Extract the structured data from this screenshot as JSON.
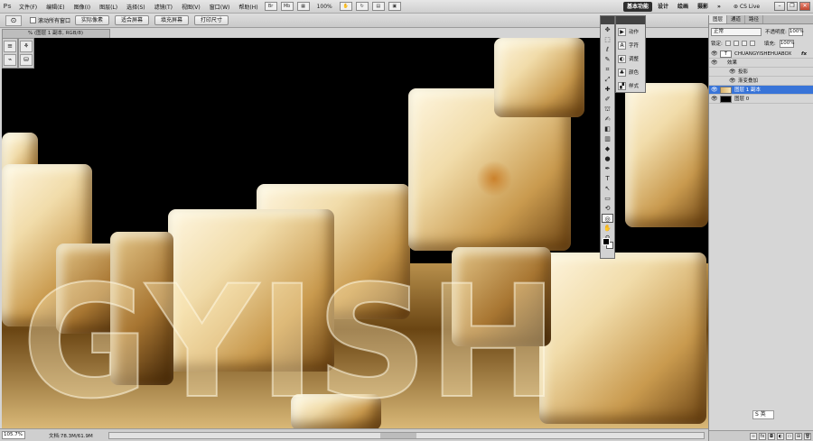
{
  "app": {
    "logo": "Ps"
  },
  "menu": [
    "文件(F)",
    "编辑(E)",
    "图像(I)",
    "图层(L)",
    "选择(S)",
    "滤镜(T)",
    "视图(V)",
    "窗口(W)",
    "帮助(H)"
  ],
  "menubar": {
    "zoom": "100%",
    "workspace_active": "基本功能",
    "workspaces": [
      "设计",
      "绘画",
      "摄影"
    ],
    "more": "»",
    "cs_live": "CS Live"
  },
  "options": {
    "scroll_all_label": "滚动所有窗口",
    "buttons": [
      "实际像素",
      "适合屏幕",
      "填充屏幕",
      "打印尺寸"
    ]
  },
  "document": {
    "tab_title": "% (图层 1 副本, RGB/8)",
    "text": "GYISH"
  },
  "status": {
    "zoom": "105.7%",
    "doc_size": "文档:78.3M/61.9M"
  },
  "flyout": [
    "动作",
    "字符",
    "调整",
    "颜色",
    "样式"
  ],
  "layers_panel": {
    "tabs": [
      "图层",
      "通道",
      "路径"
    ],
    "blend_mode": "正常",
    "opacity_label": "不透明度:",
    "opacity": "100%",
    "lock_label": "锁定:",
    "fill_label": "填充:",
    "fill": "100%",
    "layers": [
      {
        "name": "CHUANGYISHEHUABOX",
        "type": "text",
        "fx": "fx"
      },
      {
        "name": "效果",
        "type": "effect-group"
      },
      {
        "name": "投影",
        "type": "effect"
      },
      {
        "name": "渐变叠加",
        "type": "effect"
      },
      {
        "name": "图层 1 副本",
        "type": "raster",
        "selected": true
      },
      {
        "name": "图层 0",
        "type": "raster"
      }
    ]
  },
  "ime": {
    "label": "英"
  },
  "colors": {
    "selection": "#3874d8",
    "workspace_active": "#2e2e2e",
    "canvas_bg": "#000000"
  }
}
